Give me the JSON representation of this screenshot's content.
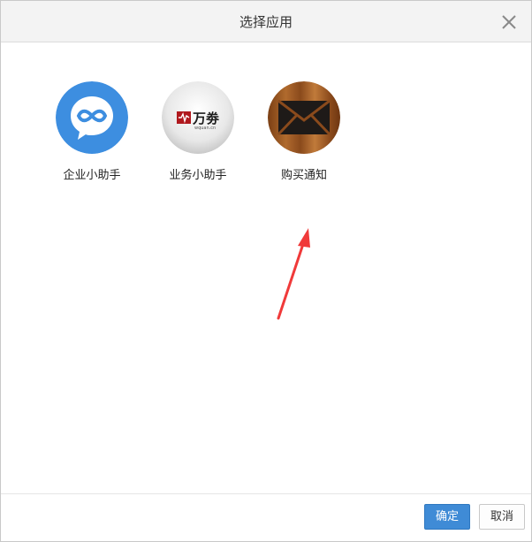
{
  "dialog": {
    "title": "选择应用",
    "close_icon": "close-icon"
  },
  "apps": [
    {
      "label": "企业小助手",
      "icon": "chat-bubble-infinity-icon",
      "color": "#3d8ee0"
    },
    {
      "label": "业务小助手",
      "icon": "wquan-logo-icon",
      "logo_text": "万劵",
      "logo_sub": "wquan.cn",
      "color": "#b0191e"
    },
    {
      "label": "购买通知",
      "icon": "envelope-icon",
      "color": "#9a5a25"
    }
  ],
  "annotation": {
    "icon": "red-arrow-icon",
    "color": "#f03a3a"
  },
  "footer": {
    "confirm_label": "确定",
    "cancel_label": "取消"
  }
}
